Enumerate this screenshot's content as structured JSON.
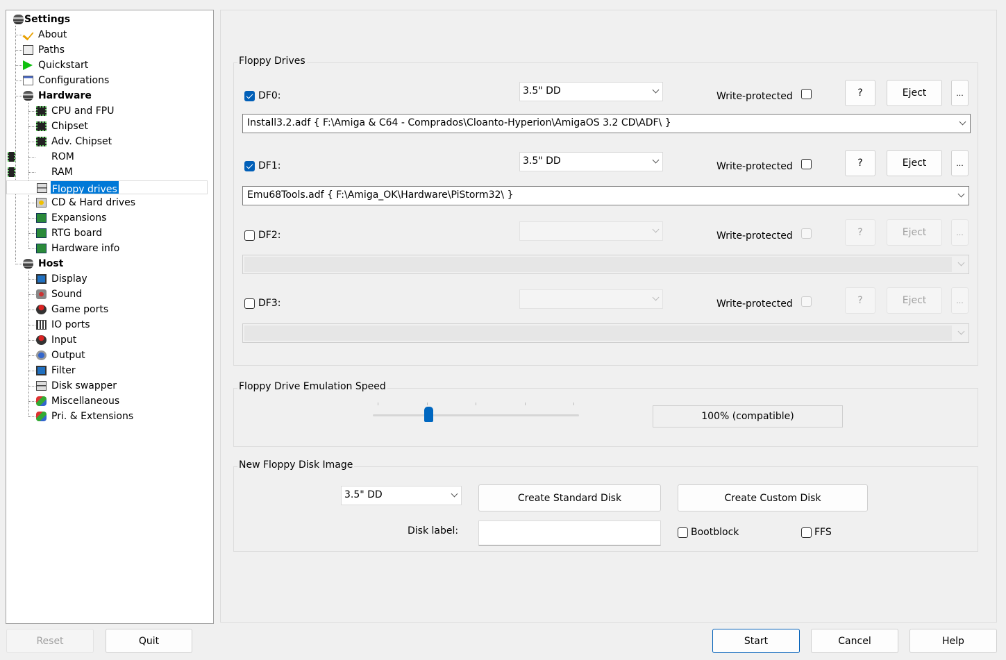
{
  "tree": [
    {
      "label": "Settings",
      "level": 0,
      "bold": true,
      "icon": "disk-stack-icon"
    },
    {
      "label": "About",
      "level": 1,
      "icon": "checkmark-icon"
    },
    {
      "label": "Paths",
      "level": 1,
      "icon": "paths-icon"
    },
    {
      "label": "Quickstart",
      "level": 1,
      "icon": "play-icon"
    },
    {
      "label": "Configurations",
      "level": 1,
      "icon": "configurations-icon"
    },
    {
      "label": "Hardware",
      "level": 1,
      "bold": true,
      "icon": "disk-stack-icon"
    },
    {
      "label": "CPU and FPU",
      "level": 2,
      "icon": "chip-icon"
    },
    {
      "label": "Chipset",
      "level": 2,
      "icon": "chip-icon"
    },
    {
      "label": "Adv. Chipset",
      "level": 2,
      "icon": "chip-icon"
    },
    {
      "label": "ROM",
      "level": 2,
      "icon": "memory-chip-icon"
    },
    {
      "label": "RAM",
      "level": 2,
      "icon": "memory-chip-icon"
    },
    {
      "label": "Floppy drives",
      "level": 2,
      "selected": true,
      "icon": "floppy-drive-icon"
    },
    {
      "label": "CD & Hard drives",
      "level": 2,
      "icon": "hard-drive-icon"
    },
    {
      "label": "Expansions",
      "level": 2,
      "icon": "expansion-card-icon"
    },
    {
      "label": "RTG board",
      "level": 2,
      "icon": "expansion-card-icon"
    },
    {
      "label": "Hardware info",
      "level": 2,
      "icon": "expansion-card-icon"
    },
    {
      "label": "Host",
      "level": 1,
      "bold": true,
      "icon": "disk-stack-icon"
    },
    {
      "label": "Display",
      "level": 2,
      "icon": "monitor-icon"
    },
    {
      "label": "Sound",
      "level": 2,
      "icon": "speaker-icon"
    },
    {
      "label": "Game ports",
      "level": 2,
      "icon": "joystick-icon"
    },
    {
      "label": "IO ports",
      "level": 2,
      "icon": "io-ports-icon"
    },
    {
      "label": "Input",
      "level": 2,
      "icon": "joystick-icon"
    },
    {
      "label": "Output",
      "level": 2,
      "icon": "output-icon"
    },
    {
      "label": "Filter",
      "level": 2,
      "icon": "monitor-icon"
    },
    {
      "label": "Disk swapper",
      "level": 2,
      "icon": "floppy-drive-icon"
    },
    {
      "label": "Miscellaneous",
      "level": 2,
      "icon": "misc-icon"
    },
    {
      "label": "Pri. & Extensions",
      "level": 2,
      "icon": "misc-icon"
    }
  ],
  "floppy": {
    "title": "Floppy Drives",
    "write_protected_label": "Write-protected",
    "help_label": "?",
    "eject_label": "Eject",
    "more_label": "...",
    "drives": [
      {
        "label": "DF0:",
        "enabled": true,
        "type": "3.5\" DD",
        "write_protected": false,
        "path": "Install3.2.adf { F:\\Amiga & C64 - Comprados\\Cloanto-Hyperion\\AmigaOS 3.2 CD\\ADF\\ }"
      },
      {
        "label": "DF1:",
        "enabled": true,
        "type": "3.5\" DD",
        "write_protected": false,
        "path": "Emu68Tools.adf { F:\\Amiga_OK\\Hardware\\PiStorm32\\ }"
      },
      {
        "label": "DF2:",
        "enabled": false,
        "type": "",
        "write_protected": false,
        "path": ""
      },
      {
        "label": "DF3:",
        "enabled": false,
        "type": "",
        "write_protected": false,
        "path": ""
      }
    ]
  },
  "speed": {
    "title": "Floppy Drive Emulation Speed",
    "slider_position": 0.27,
    "value_label": "100% (compatible)"
  },
  "newdisk": {
    "title": "New Floppy Disk Image",
    "type": "3.5\" DD",
    "create_standard": "Create Standard Disk",
    "create_custom": "Create Custom Disk",
    "disk_label": "Disk label:",
    "disk_label_value": "",
    "bootblock": "Bootblock",
    "bootblock_checked": false,
    "ffs": "FFS",
    "ffs_checked": false
  },
  "footer": {
    "reset": "Reset",
    "quit": "Quit",
    "start": "Start",
    "cancel": "Cancel",
    "help": "Help"
  },
  "colors": {
    "accent": "#005fb8",
    "selection": "#0078d7"
  }
}
